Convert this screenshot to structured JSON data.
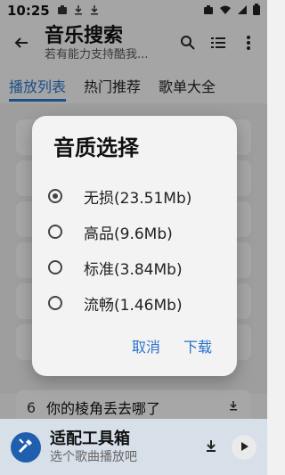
{
  "status": {
    "time": "10:25",
    "left_icons": [
      "briefcase-icon",
      "download-icon",
      "download-icon"
    ],
    "right_icons": [
      "briefcase-icon",
      "wifi-icon",
      "signal-icon",
      "battery-icon"
    ]
  },
  "appbar": {
    "title": "音乐搜索",
    "subtitle": "若有能力支持酷我...",
    "actions": [
      "search-icon",
      "list-icon",
      "more-vert-icon"
    ]
  },
  "tabs": [
    {
      "label": "播放列表",
      "active": true
    },
    {
      "label": "热门推荐",
      "active": false
    },
    {
      "label": "歌单大全",
      "active": false
    }
  ],
  "list": {
    "visible_item": {
      "index": "6",
      "title": "你的棱角丢去哪了"
    }
  },
  "dialog": {
    "title": "音质选择",
    "options": [
      {
        "label": "无损(23.51Mb)",
        "checked": true
      },
      {
        "label": "高品(9.6Mb)",
        "checked": false
      },
      {
        "label": "标准(3.84Mb)",
        "checked": false
      },
      {
        "label": "流畅(1.46Mb)",
        "checked": false
      }
    ],
    "cancel_label": "取消",
    "confirm_label": "下载"
  },
  "player": {
    "title": "适配工具箱",
    "subtitle": "选个歌曲播放吧"
  },
  "colors": {
    "accent": "#2a73c9",
    "player_bg": "#d7dfe8",
    "logo_bg": "#1f5fae"
  }
}
